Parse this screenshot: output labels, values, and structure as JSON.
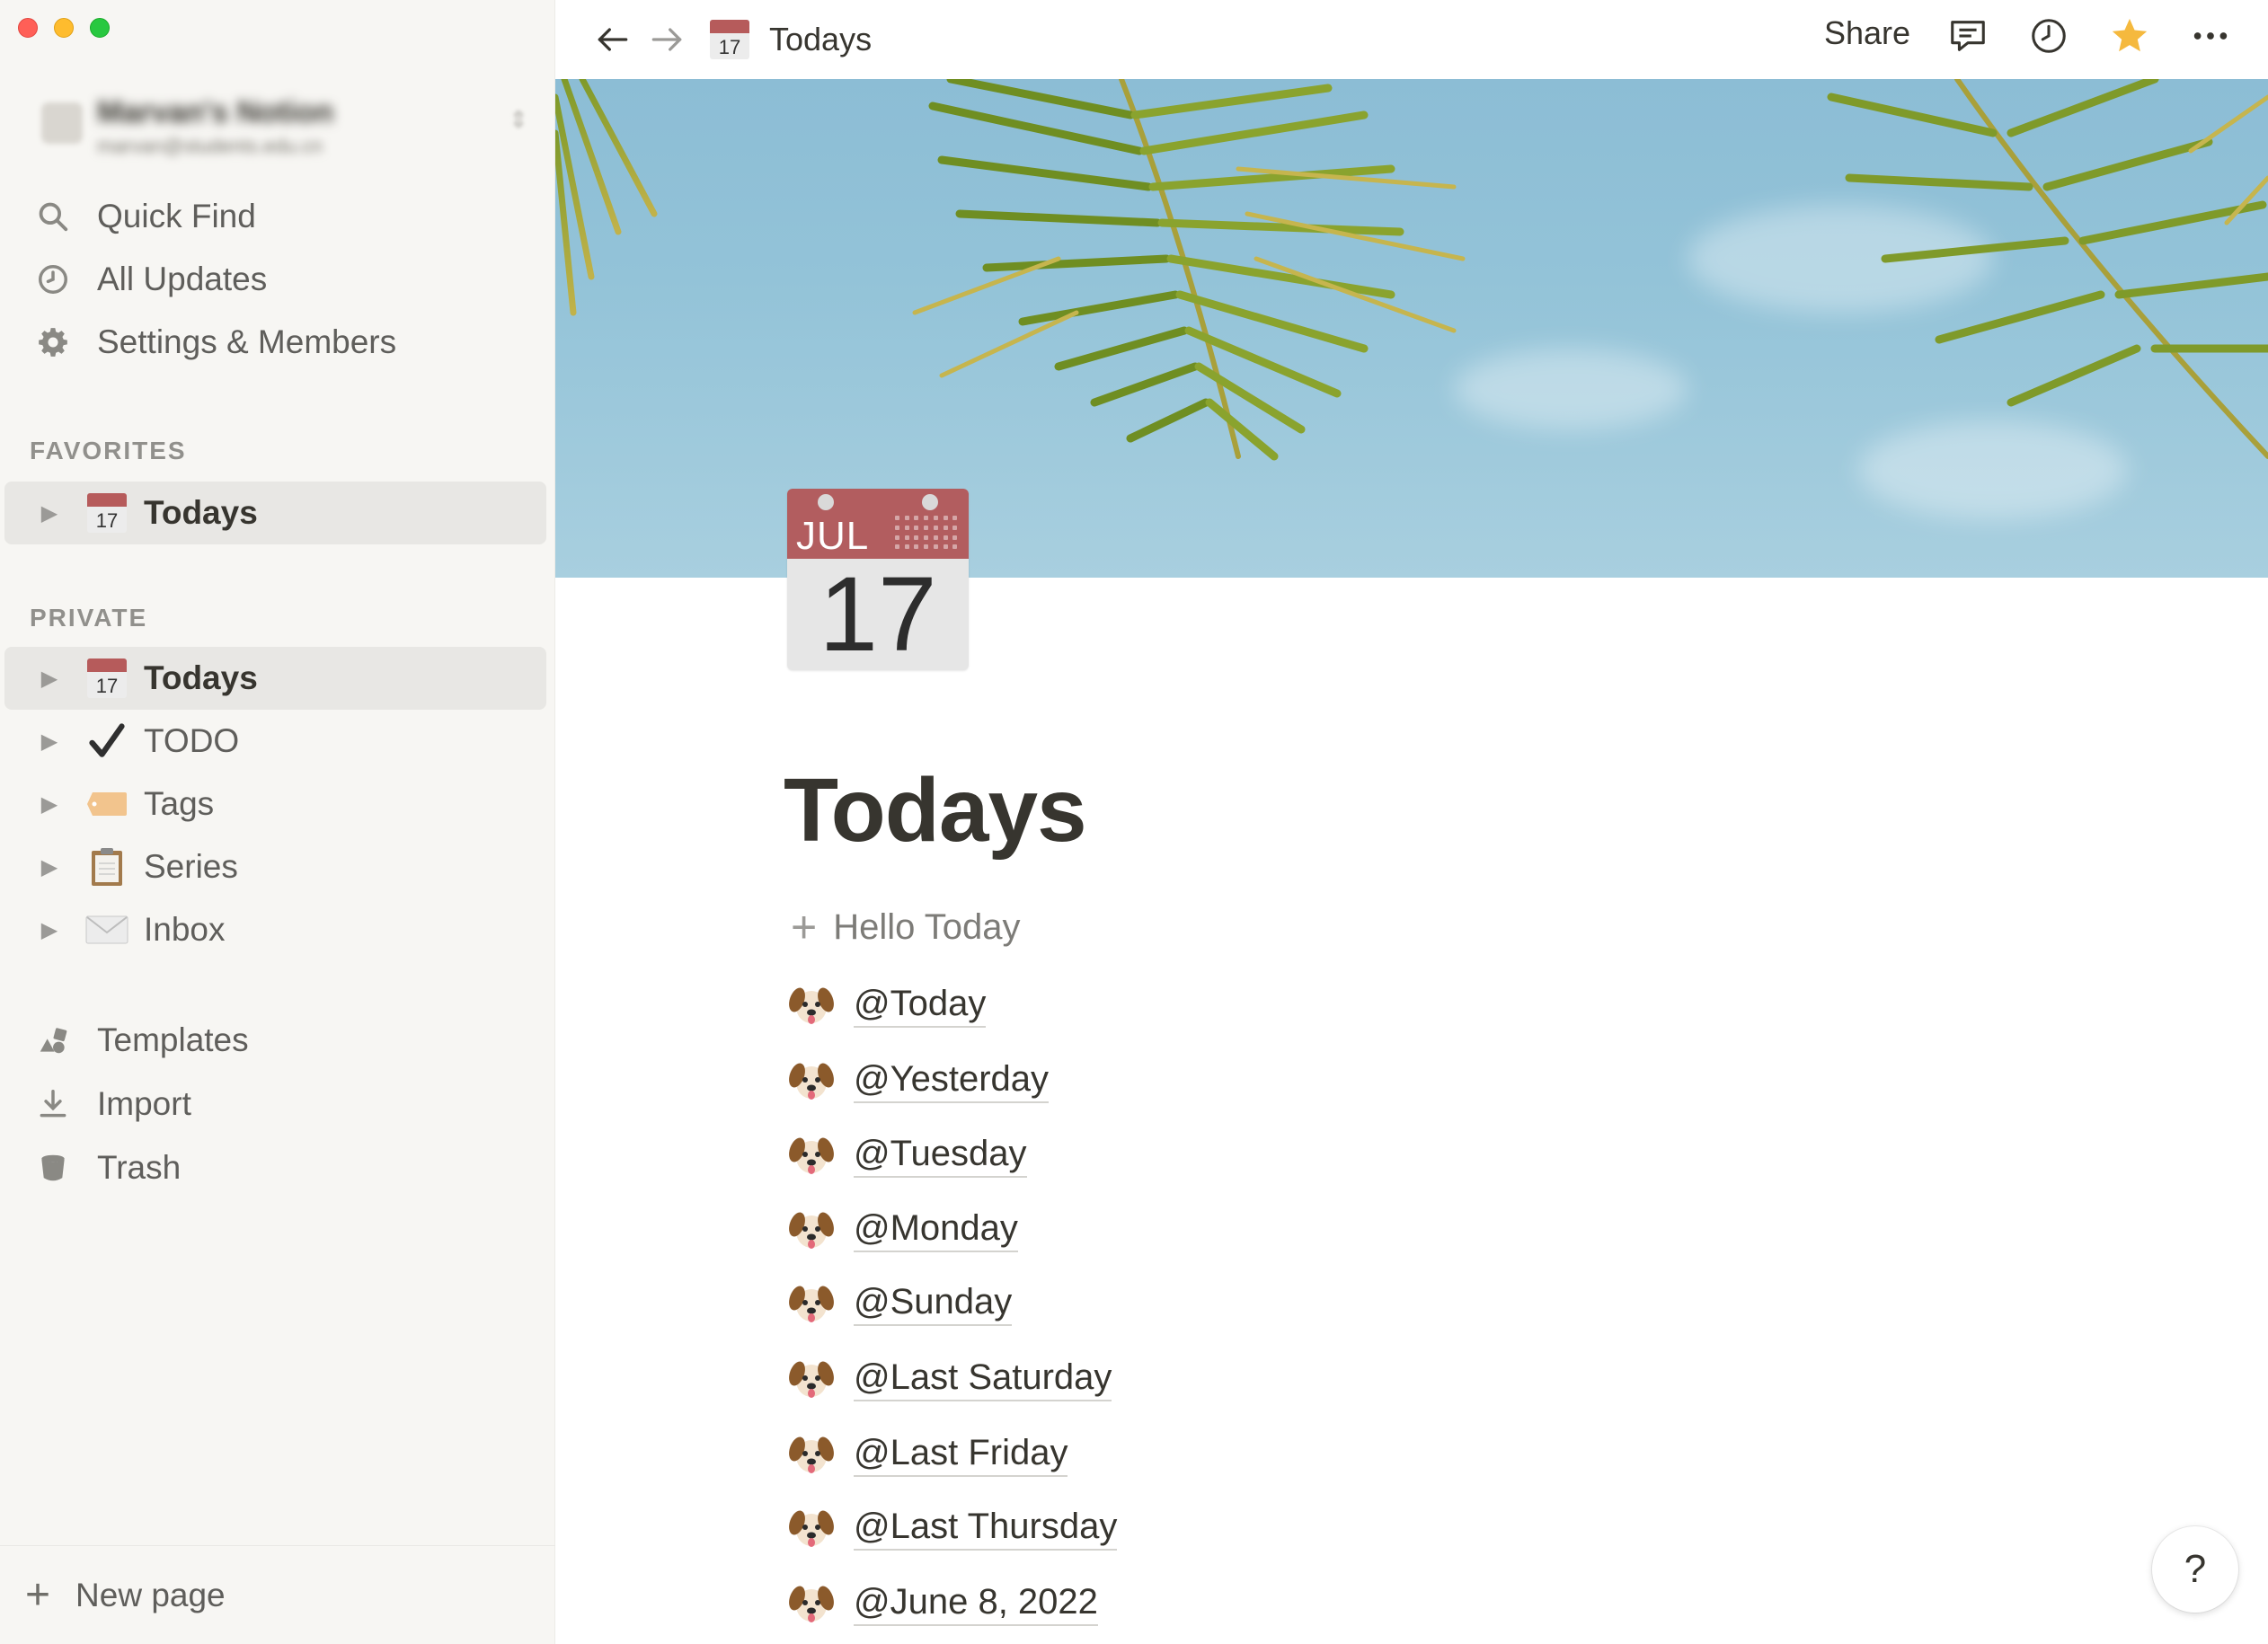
{
  "sidebar": {
    "workspace": {
      "name": "Marvan's Notion",
      "email": "marvan@students.edu.cn"
    },
    "nav": [
      {
        "label": "Quick Find",
        "icon": "search-icon"
      },
      {
        "label": "All Updates",
        "icon": "clock-icon"
      },
      {
        "label": "Settings & Members",
        "icon": "gear-icon"
      }
    ],
    "favorites_label": "FAVORITES",
    "favorites": [
      {
        "label": "Todays",
        "icon": "calendar-icon",
        "day": "17",
        "active": true
      }
    ],
    "private_label": "PRIVATE",
    "private": [
      {
        "label": "Todays",
        "icon": "calendar-icon",
        "day": "17",
        "active": true
      },
      {
        "label": "TODO",
        "icon": "checkmark-icon"
      },
      {
        "label": "Tags",
        "icon": "tag-icon"
      },
      {
        "label": "Series",
        "icon": "clipboard-icon"
      },
      {
        "label": "Inbox",
        "icon": "envelope-icon"
      }
    ],
    "tools": [
      {
        "label": "Templates",
        "icon": "templates-icon"
      },
      {
        "label": "Import",
        "icon": "import-icon"
      },
      {
        "label": "Trash",
        "icon": "trash-icon"
      }
    ],
    "new_page": "New page"
  },
  "topbar": {
    "breadcrumb": "Todays",
    "breadcrumb_day": "17",
    "share": "Share"
  },
  "page": {
    "icon_month": "JUL",
    "icon_day": "17",
    "title": "Todays",
    "add_button": "Hello Today",
    "mentions": [
      "@Today",
      "@Yesterday",
      "@Tuesday",
      "@Monday",
      "@Sunday",
      "@Last Saturday",
      "@Last Friday",
      "@Last Thursday",
      "@June 8, 2022"
    ]
  },
  "help": "?",
  "colors": {
    "accent_star": "#f5b93e",
    "calendar_red": "#b25d5f",
    "sidebar_bg": "#f7f6f3"
  }
}
